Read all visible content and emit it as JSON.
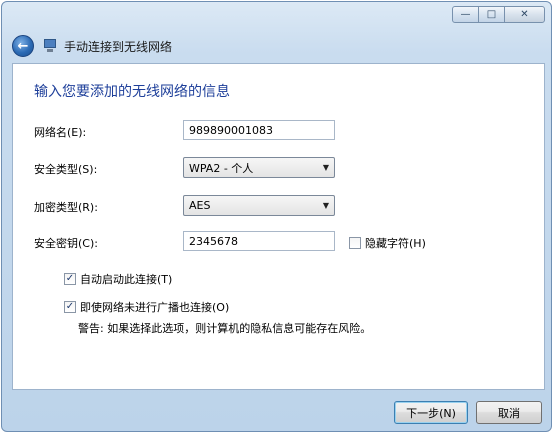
{
  "window": {
    "title": "手动连接到无线网络",
    "minimize_glyph": "—",
    "maximize_glyph": "□",
    "close_glyph": "✕"
  },
  "nav": {
    "back_glyph": "←"
  },
  "form": {
    "heading": "输入您要添加的无线网络的信息",
    "network_name": {
      "label": "网络名(E):",
      "value": "989890001083"
    },
    "security_type": {
      "label": "安全类型(S):",
      "value": "WPA2 - 个人"
    },
    "encryption_type": {
      "label": "加密类型(R):",
      "value": "AES"
    },
    "security_key": {
      "label": "安全密钥(C):",
      "value": "2345678"
    },
    "hide_characters": {
      "label": "隐藏字符(H)",
      "checked": false
    },
    "auto_connect": {
      "label": "自动启动此连接(T)",
      "checked": true
    },
    "connect_hidden": {
      "label": "即使网络未进行广播也连接(O)",
      "checked": true
    },
    "warning": "警告: 如果选择此选项，则计算机的隐私信息可能存在风险。"
  },
  "footer": {
    "next_label": "下一步(N)",
    "cancel_label": "取消"
  },
  "icons": {
    "check": "✓",
    "dropdown": "▼"
  },
  "colors": {
    "heading": "#1e3f9a",
    "frame": "#bcd3ea"
  }
}
